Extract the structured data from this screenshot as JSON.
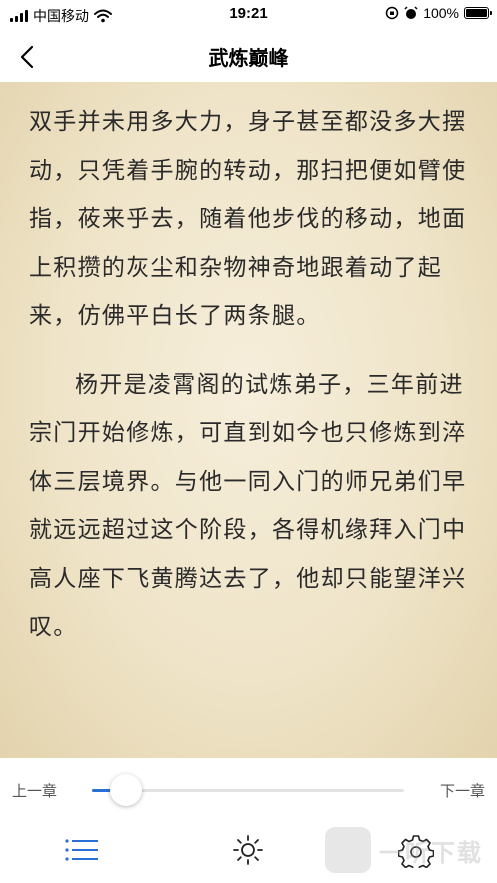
{
  "status_bar": {
    "carrier": "中国移动",
    "time": "19:21",
    "battery": "100%"
  },
  "nav": {
    "title": "武炼巅峰"
  },
  "content": {
    "paragraphs": [
      "双手并未用多大力，身子甚至都没多大摆动，只凭着手腕的转动，那扫把便如臂使指，莜来乎去，随着他步伐的移动，地面上积攒的灰尘和杂物神奇地跟着动了起来，仿佛平白长了两条腿。",
      "杨开是凌霄阁的试炼弟子，三年前进宗门开始修炼，可直到如今也只修炼到淬体三层境界。与他一同入门的师兄弟们早就远远超过这个阶段，各得机缘拜入门中高人座下飞黄腾达去了，他却只能望洋兴叹。"
    ]
  },
  "controls": {
    "prev_chapter": "上一章",
    "next_chapter": "下一章",
    "progress": 0.11,
    "accent_color": "#2a6fd6",
    "icons": [
      "menu-icon",
      "brightness-icon",
      "settings-icon"
    ]
  },
  "watermark": {
    "text": "一听下载"
  }
}
